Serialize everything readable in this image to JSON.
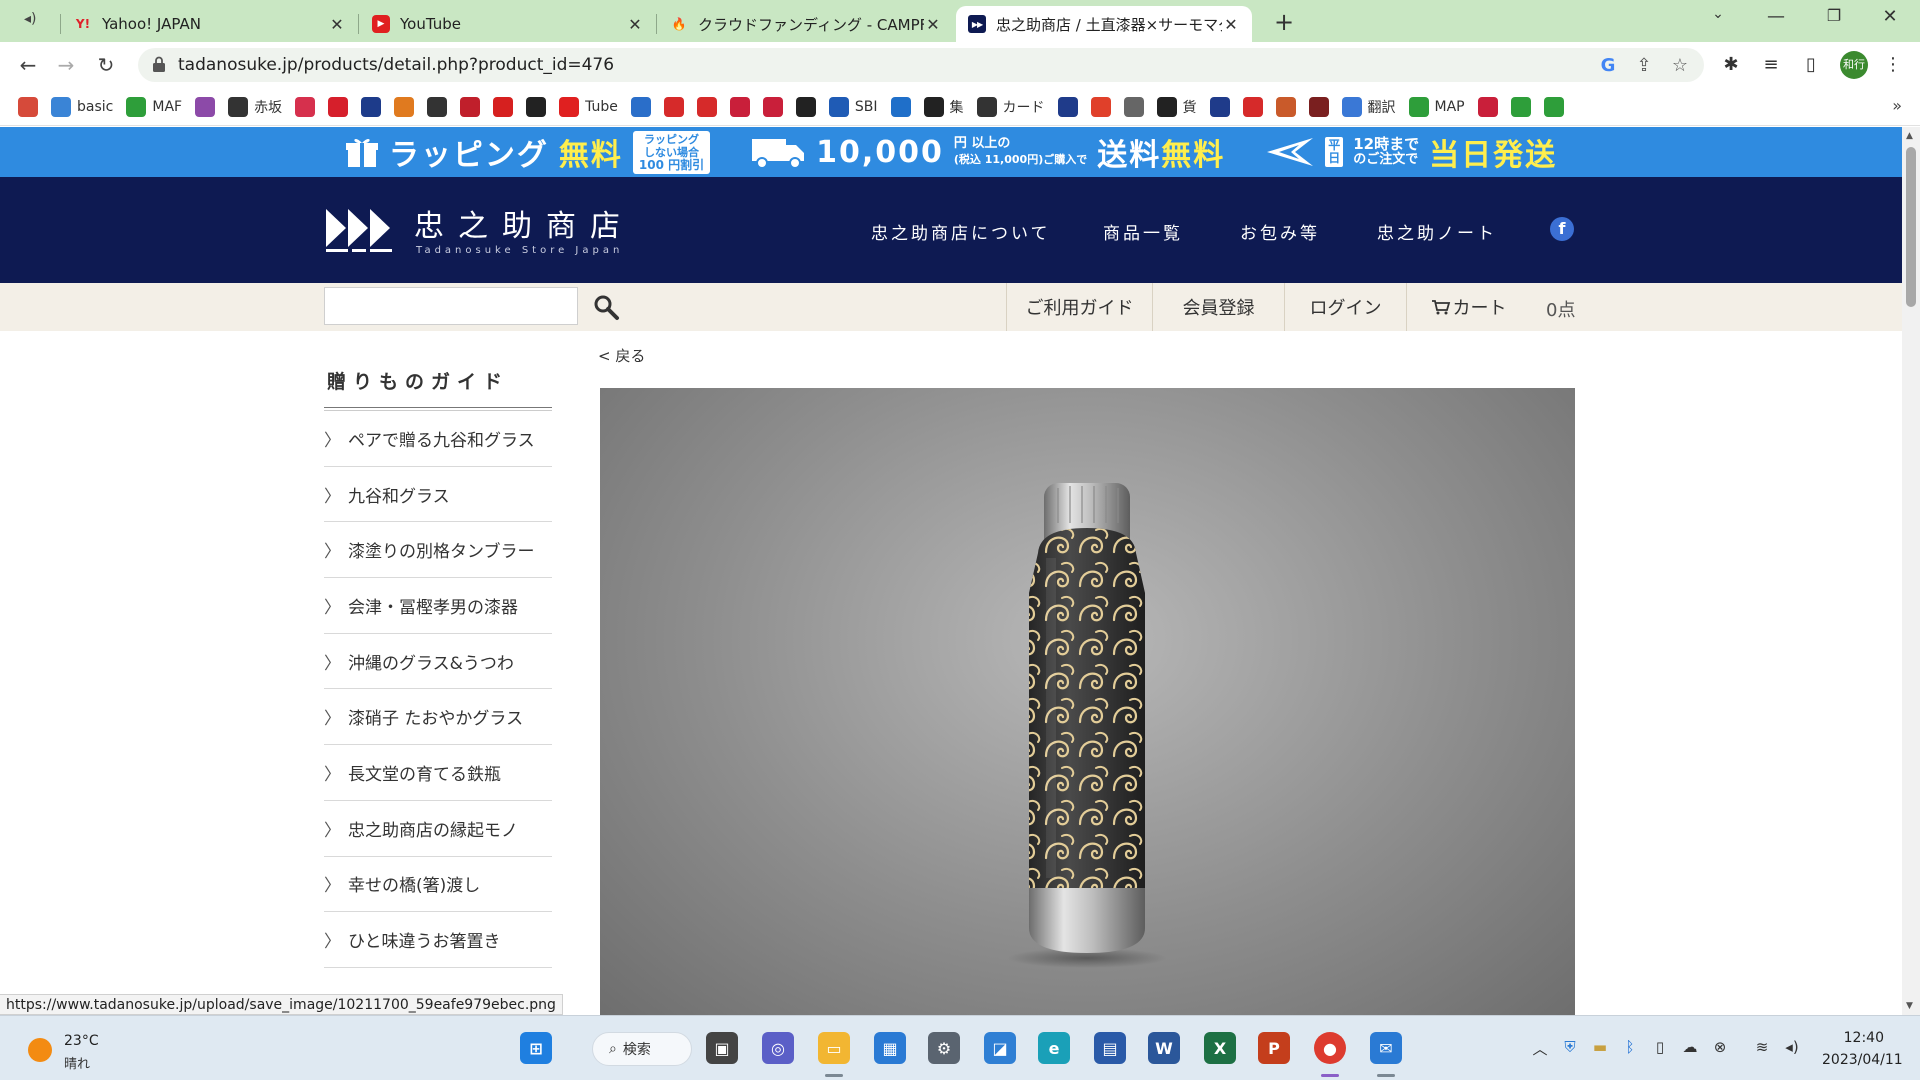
{
  "browser": {
    "tabs": [
      {
        "title": "Yahoo! JAPAN",
        "favicon": "Y!"
      },
      {
        "title": "YouTube",
        "favicon": "▶"
      },
      {
        "title": "クラウドファンディング - CAMPFIRE (キ",
        "favicon": "🔥"
      },
      {
        "title": "忠之助商店 / 土直漆器×サーモマグ",
        "favicon": "▶▶"
      }
    ],
    "url": "tadanosuke.jp/products/detail.php?product_id=476",
    "profile_label": "和行",
    "bookmarks": [
      {
        "label": "",
        "color": "#d64a3a"
      },
      {
        "label": "basic",
        "color": "#3a84d6"
      },
      {
        "label": "MAF",
        "color": "#2e9e3a"
      },
      {
        "label": "",
        "color": "#8c4aa8"
      },
      {
        "label": "赤坂",
        "color": "#333333"
      },
      {
        "label": "",
        "color": "#d6304d"
      },
      {
        "label": "",
        "color": "#d61f2b"
      },
      {
        "label": "",
        "color": "#1d3b8a"
      },
      {
        "label": "",
        "color": "#e07a1f"
      },
      {
        "label": "",
        "color": "#333333"
      },
      {
        "label": "",
        "color": "#c01f2b"
      },
      {
        "label": "",
        "color": "#d6201f"
      },
      {
        "label": "",
        "color": "#222222"
      },
      {
        "label": "Tube",
        "color": "#e02020"
      },
      {
        "label": "",
        "color": "#2a6ec9"
      },
      {
        "label": "",
        "color": "#d62a2a"
      },
      {
        "label": "",
        "color": "#d62a2a"
      },
      {
        "label": "",
        "color": "#c91f3a"
      },
      {
        "label": "",
        "color": "#c91f3a"
      },
      {
        "label": "",
        "color": "#222222"
      },
      {
        "label": "SBI",
        "color": "#1f5bb5"
      },
      {
        "label": "",
        "color": "#1f6fc9"
      },
      {
        "label": "集",
        "color": "#222222"
      },
      {
        "label": "カード",
        "color": "#333333"
      },
      {
        "label": "",
        "color": "#1f3b8a"
      },
      {
        "label": "",
        "color": "#e0402a"
      },
      {
        "label": "",
        "color": "#666666"
      },
      {
        "label": "貨",
        "color": "#222222"
      },
      {
        "label": "",
        "color": "#1f3b8a"
      },
      {
        "label": "",
        "color": "#d62a2a"
      },
      {
        "label": "",
        "color": "#c95a2a"
      },
      {
        "label": "",
        "color": "#7a1f1f"
      },
      {
        "label": "翻訳",
        "color": "#3a78d6"
      },
      {
        "label": "MAP",
        "color": "#2e9e3a"
      },
      {
        "label": "",
        "color": "#c91f3a"
      },
      {
        "label": "",
        "color": "#2e9e3a"
      },
      {
        "label": "",
        "color": "#2e9e3a"
      }
    ],
    "status_url": "https://www.tadanosuke.jp/upload/save_image/10211700_59eafe979ebec.png"
  },
  "page": {
    "promo": {
      "wrapping_label": "ラッピング",
      "wrapping_free": "無料",
      "wrapping_badge_1": "ラッピング",
      "wrapping_badge_2": "しない場合",
      "wrapping_badge_3": "100 円割引",
      "shipping_amount": "10,000",
      "shipping_unit": "円 以上の",
      "shipping_cond": "(税込 11,000円)ご購入で",
      "shipping_label": "送料",
      "shipping_free": "無料",
      "sameday_badge": "平日",
      "sameday_time": "12時まで",
      "sameday_cond": "のご注文で",
      "sameday_label": "当日発送"
    },
    "header": {
      "logo_text": "忠之助商店",
      "logo_sub": "Tadanosuke Store Japan",
      "nav": [
        "忠之助商店について",
        "商品一覧",
        "お包み等",
        "忠之助ノート"
      ],
      "facebook": "f"
    },
    "subbar": {
      "search_placeholder": "",
      "links": [
        "ご利用ガイド",
        "会員登録",
        "ログイン",
        "カート"
      ],
      "cart_count": "0点"
    },
    "sidebar": {
      "title": "贈りものガイド",
      "items": [
        "ペアで贈る九谷和グラス",
        "九谷和グラス",
        "漆塗りの別格タンブラー",
        "会津・冨樫孝男の漆器",
        "沖縄のグラス&うつわ",
        "漆硝子 たおやかグラス",
        "長文堂の育てる鉄瓶",
        "忠之助商店の縁起モノ",
        "幸せの橋(箸)渡し",
        "ひと味違うお箸置き"
      ]
    },
    "back_label": "< 戻る"
  },
  "taskbar": {
    "temp": "23°C",
    "weather": "晴れ",
    "search_label": "検索",
    "time": "12:40",
    "date": "2023/04/11"
  }
}
